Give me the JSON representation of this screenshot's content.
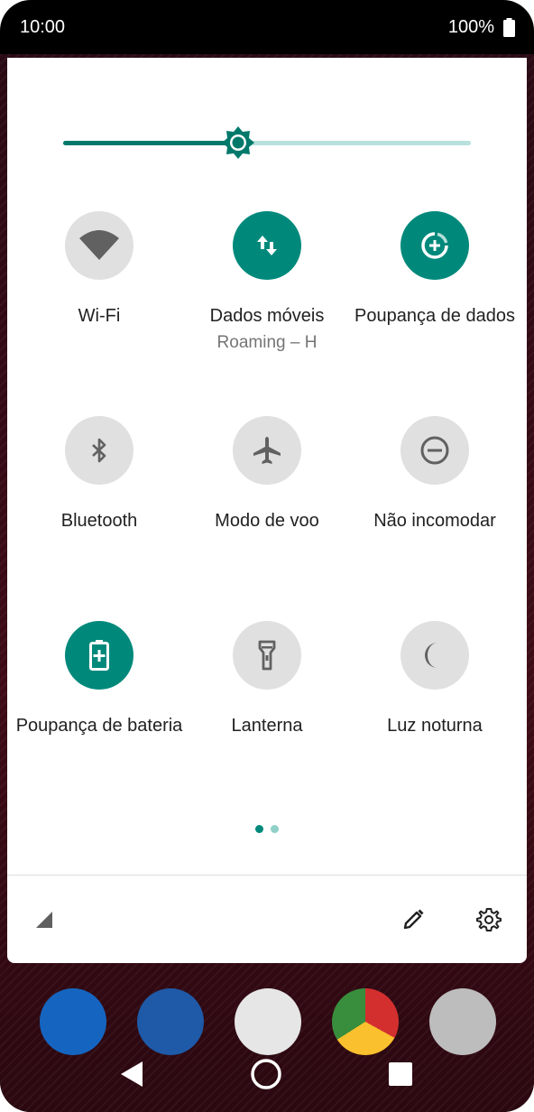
{
  "status_bar": {
    "time": "10:00",
    "battery_percent": "100%"
  },
  "brightness": {
    "level_fraction": 0.43
  },
  "tiles": [
    {
      "label": "Wi-Fi",
      "state": "off",
      "icon": "wifi-icon"
    },
    {
      "label": "Dados móveis",
      "sublabel": "Roaming – H",
      "state": "on",
      "icon": "mobile-data-icon"
    },
    {
      "label": "Poupança de dados",
      "state": "on",
      "icon": "data-saver-icon"
    },
    {
      "label": "Bluetooth",
      "state": "off",
      "icon": "bluetooth-icon"
    },
    {
      "label": "Modo de voo",
      "state": "off",
      "icon": "airplane-icon"
    },
    {
      "label": "Não incomodar",
      "state": "off",
      "icon": "do-not-disturb-icon"
    },
    {
      "label": "Poupança de bateria",
      "state": "on",
      "icon": "battery-saver-icon"
    },
    {
      "label": "Lanterna",
      "state": "off",
      "icon": "flashlight-icon"
    },
    {
      "label": "Luz noturna",
      "state": "off",
      "icon": "night-light-icon"
    }
  ],
  "pages": {
    "count": 2,
    "current": 1
  },
  "colors": {
    "accent": "#00897b",
    "accent_dark": "#00796b",
    "accent_light": "#b7e1dd",
    "tile_off": "#e0e0e0",
    "icon_off": "#5f5f5f"
  },
  "footer": {
    "signal_icon": "signal-icon",
    "edit_icon": "edit-icon",
    "settings_icon": "settings-icon"
  },
  "nav": {
    "back_icon": "back-icon",
    "home_icon": "home-icon",
    "recents_icon": "recents-icon"
  }
}
